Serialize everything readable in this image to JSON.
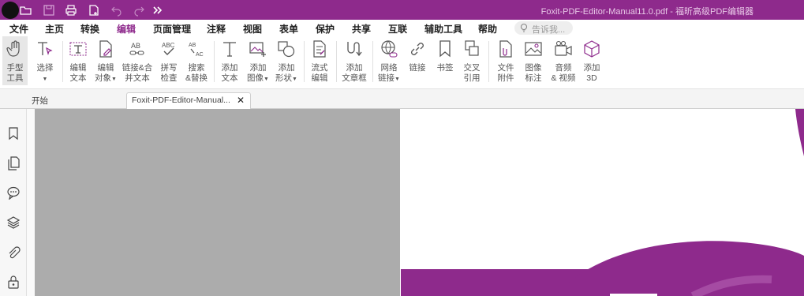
{
  "window": {
    "title": "Foxit-PDF-Editor-Manual11.0.pdf - 福昕高级PDF编辑器"
  },
  "colors": {
    "brand": "#8e2a8c",
    "ribbon_active": "#e7e7e7",
    "canvas_gray": "#acacac"
  },
  "quick_access": [
    {
      "name": "open-icon"
    },
    {
      "name": "save-icon"
    },
    {
      "name": "print-icon"
    },
    {
      "name": "new-document-icon"
    },
    {
      "name": "undo-icon"
    },
    {
      "name": "redo-icon"
    },
    {
      "name": "more-icon"
    }
  ],
  "menu": {
    "items": [
      "文件",
      "主页",
      "转换",
      "编辑",
      "页面管理",
      "注释",
      "视图",
      "表单",
      "保护",
      "共享",
      "互联",
      "辅助工具",
      "帮助"
    ],
    "active": "编辑"
  },
  "search": {
    "placeholder": "告诉我..."
  },
  "ribbon": {
    "tools": [
      {
        "label": "手型\n工具",
        "icon": "hand-icon"
      },
      {
        "label": "选择",
        "icon": "select-text-icon",
        "dropdown": true
      },
      {
        "label": "编辑\n文本",
        "icon": "edit-text-icon"
      },
      {
        "label": "编辑\n对象",
        "icon": "edit-object-icon",
        "dropdown": true
      },
      {
        "label": "链接&合\n并文本",
        "icon": "link-merge-text-icon"
      },
      {
        "label": "拼写\n检查",
        "icon": "spell-check-icon"
      },
      {
        "label": "搜索\n&替换",
        "icon": "search-replace-icon"
      },
      {
        "label": "添加\n文本",
        "icon": "add-text-icon"
      },
      {
        "label": "添加\n图像",
        "icon": "add-image-icon",
        "dropdown": true
      },
      {
        "label": "添加\n形状",
        "icon": "add-shape-icon",
        "dropdown": true
      },
      {
        "label": "流式\n编辑",
        "icon": "reflow-edit-icon"
      },
      {
        "label": "添加\n文章框",
        "icon": "article-box-icon"
      },
      {
        "label": "网络\n链接",
        "icon": "web-link-icon",
        "dropdown": true
      },
      {
        "label": "链接",
        "icon": "link-icon"
      },
      {
        "label": "书签",
        "icon": "bookmark-icon"
      },
      {
        "label": "交叉\n引用",
        "icon": "cross-reference-icon"
      },
      {
        "label": "文件\n附件",
        "icon": "file-attachment-icon"
      },
      {
        "label": "图像\n标注",
        "icon": "image-annotation-icon"
      },
      {
        "label": "音频\n& 视频",
        "icon": "audio-video-icon"
      },
      {
        "label": "添加\n3D",
        "icon": "add-3d-icon"
      }
    ]
  },
  "tabs": [
    {
      "label": "开始"
    },
    {
      "label": "Foxit-PDF-Editor-Manual..."
    }
  ],
  "sidebar": {
    "icons": [
      "bookmark-panel-icon",
      "pages-panel-icon",
      "comments-panel-icon",
      "layers-panel-icon",
      "attachments-panel-icon",
      "security-panel-icon"
    ]
  }
}
